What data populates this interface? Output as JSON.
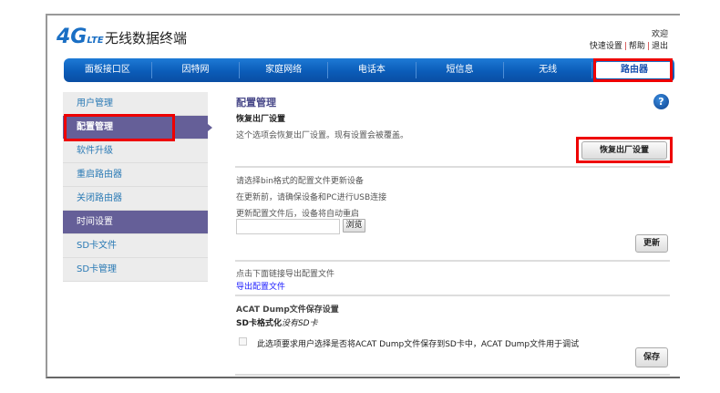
{
  "header": {
    "logo": "4G",
    "logo_sub": "LTE",
    "title": "无线数据终端",
    "welcome": "欢迎",
    "links": [
      "快速设置",
      "帮助",
      "退出"
    ]
  },
  "nav": {
    "tabs": [
      "面板接口区",
      "因特网",
      "家庭网络",
      "电话本",
      "短信息",
      "无线",
      "路由器"
    ],
    "active": "路由器"
  },
  "sidebar": {
    "items": [
      "用户管理",
      "配置管理",
      "软件升级",
      "重启路由器",
      "关闭路由器",
      "时间设置",
      "SD卡文件",
      "SD卡管理"
    ],
    "selected": "配置管理"
  },
  "main": {
    "title": "配置管理",
    "restore": {
      "heading": "恢复出厂设置",
      "desc": "这个选项会恢复出厂设置。现有设置会被覆盖。",
      "button": "恢复出厂设置"
    },
    "update": {
      "line1": "请选择bin格式的配置文件更新设备",
      "line2": "在更新前，请确保设备和PC进行USB连接",
      "line3": "更新配置文件后，设备将自动重启",
      "file_value": "",
      "browse": "浏览",
      "button": "更新"
    },
    "export": {
      "desc": "点击下面链接导出配置文件",
      "link": "导出配置文件"
    },
    "acat": {
      "heading": "ACAT Dump文件保存设置",
      "sd_label": "SD卡格式化",
      "sd_status": "没有SD卡",
      "checkbox_label": "此选项要求用户选择是否将ACAT Dump文件保存到SD卡中，ACAT Dump文件用于调试",
      "checked": false,
      "button": "保存"
    }
  },
  "colors": {
    "nav": "#0b5cb8",
    "sidebar_selected": "#655f98",
    "highlight": "#ee0000",
    "link": "#1a1aff"
  }
}
